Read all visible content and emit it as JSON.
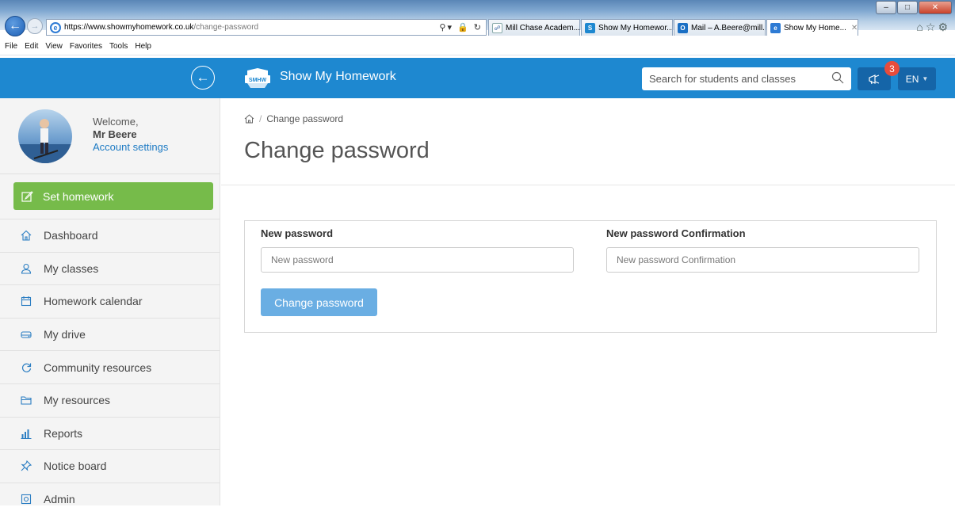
{
  "browser": {
    "url_host": "https://www.showmyhomework.co.uk",
    "url_path": "/change-password",
    "tabs": [
      {
        "label": "Mill Chase Academ...",
        "active": false
      },
      {
        "label": "Show My Homewor...",
        "active": false
      },
      {
        "label": "Mail – A.Beere@mill...",
        "active": false
      },
      {
        "label": "Show My Home...",
        "active": true
      }
    ],
    "menu": [
      "File",
      "Edit",
      "View",
      "Favorites",
      "Tools",
      "Help"
    ]
  },
  "header": {
    "brand": "Show My Homework",
    "logo_text": "SMHW",
    "search_placeholder": "Search for students and classes",
    "notification_count": "3",
    "language": "EN",
    "colors": {
      "primary": "#1e88d0",
      "dark": "#1565a8"
    }
  },
  "sidebar": {
    "welcome": "Welcome,",
    "user_name": "Mr Beere",
    "account_settings": "Account settings",
    "set_homework": "Set homework",
    "items": [
      {
        "label": "Dashboard",
        "icon": "home-icon"
      },
      {
        "label": "My classes",
        "icon": "user-icon"
      },
      {
        "label": "Homework calendar",
        "icon": "calendar-icon"
      },
      {
        "label": "My drive",
        "icon": "drive-icon"
      },
      {
        "label": "Community resources",
        "icon": "refresh-icon"
      },
      {
        "label": "My resources",
        "icon": "folder-icon"
      },
      {
        "label": "Reports",
        "icon": "bar-chart-icon"
      },
      {
        "label": "Notice board",
        "icon": "pin-icon"
      },
      {
        "label": "Admin",
        "icon": "gear-icon"
      }
    ]
  },
  "main": {
    "breadcrumb_current": "Change password",
    "title": "Change password",
    "form": {
      "new_password_label": "New password",
      "new_password_placeholder": "New password",
      "confirm_label": "New password Confirmation",
      "confirm_placeholder": "New password Confirmation",
      "submit_label": "Change password"
    }
  }
}
